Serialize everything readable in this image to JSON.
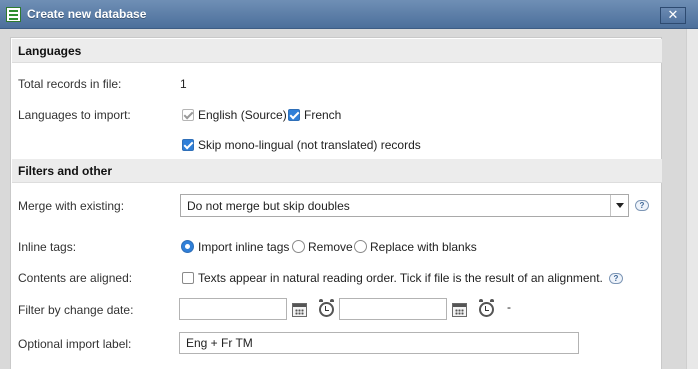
{
  "window": {
    "title": "Create new database",
    "close_label": "✕"
  },
  "languages": {
    "header": "Languages",
    "total_records_label": "Total records in file:",
    "total_records_value": "1",
    "languages_label": "Languages to import:",
    "english_label": "English (Source)",
    "french_label": "French",
    "skip_mono_label": "Skip mono-lingual (not translated) records"
  },
  "filters": {
    "header": "Filters and other",
    "merge_label": "Merge with existing:",
    "merge_value": "Do not merge but skip doubles",
    "inline_tags_label": "Inline tags:",
    "inline_options": [
      "Import inline tags",
      "Remove",
      "Replace with blanks"
    ],
    "aligned_label": "Contents are aligned:",
    "aligned_text": "Texts appear in natural reading order. Tick if file is the result of an alignment.",
    "filter_date_label": "Filter by change date:",
    "date_from_value": "",
    "date_to_value": "",
    "date_separator": "-",
    "import_label_label": "Optional import label:",
    "import_label_value": "Eng + Fr TM"
  },
  "colors": {
    "titlebar": "#5b7ca6",
    "accent": "#2f7fd8",
    "section_bg": "#ececec"
  }
}
